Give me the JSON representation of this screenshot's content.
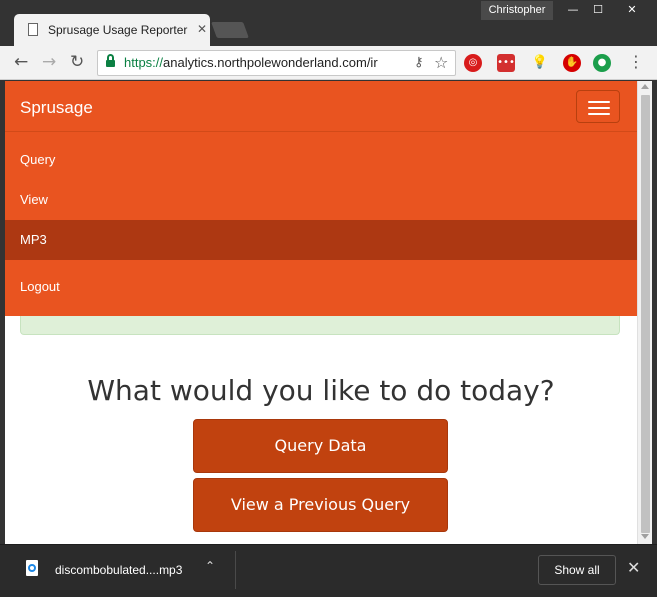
{
  "window": {
    "profile_name": "Christopher",
    "min_glyph": "—",
    "max_glyph": "☐",
    "close_glyph": "✕"
  },
  "tab": {
    "title": "Sprusage Usage Reporter",
    "close_glyph": "✕"
  },
  "toolbar": {
    "back_glyph": "←",
    "forward_glyph": "→",
    "reload_glyph": "↻",
    "url_scheme": "https://",
    "url_rest": "analytics.northpolewonderland.com/ir",
    "key_glyph": "⚷",
    "star_glyph": "☆",
    "menu_glyph": "⋮",
    "extensions": [
      {
        "icon": "adobe-acrobat-icon",
        "glyph": "◎"
      },
      {
        "icon": "lastpass-icon",
        "glyph": "•••"
      },
      {
        "icon": "lightbulb-icon",
        "glyph": "💡"
      },
      {
        "icon": "ublock-icon",
        "glyph": "✋"
      },
      {
        "icon": "evernote-icon",
        "glyph": "●"
      }
    ]
  },
  "navbar": {
    "brand": "Sprusage",
    "items": [
      {
        "label": "Query",
        "active": false
      },
      {
        "label": "View",
        "active": false
      },
      {
        "label": "MP3",
        "active": true
      },
      {
        "label": "Logout",
        "active": false
      }
    ]
  },
  "main": {
    "heading": "What would you like to do today?",
    "query_button": "Query Data",
    "view_button": "View a Previous Query"
  },
  "downloads": {
    "file_name": "discombobulated....mp3",
    "chevron_glyph": "⌃",
    "show_all": "Show all",
    "close_glyph": "✕"
  },
  "colors": {
    "accent": "#e95420",
    "active_nav": "#ad3812",
    "button": "#c1420f",
    "alert_bg": "#dff0d8"
  }
}
